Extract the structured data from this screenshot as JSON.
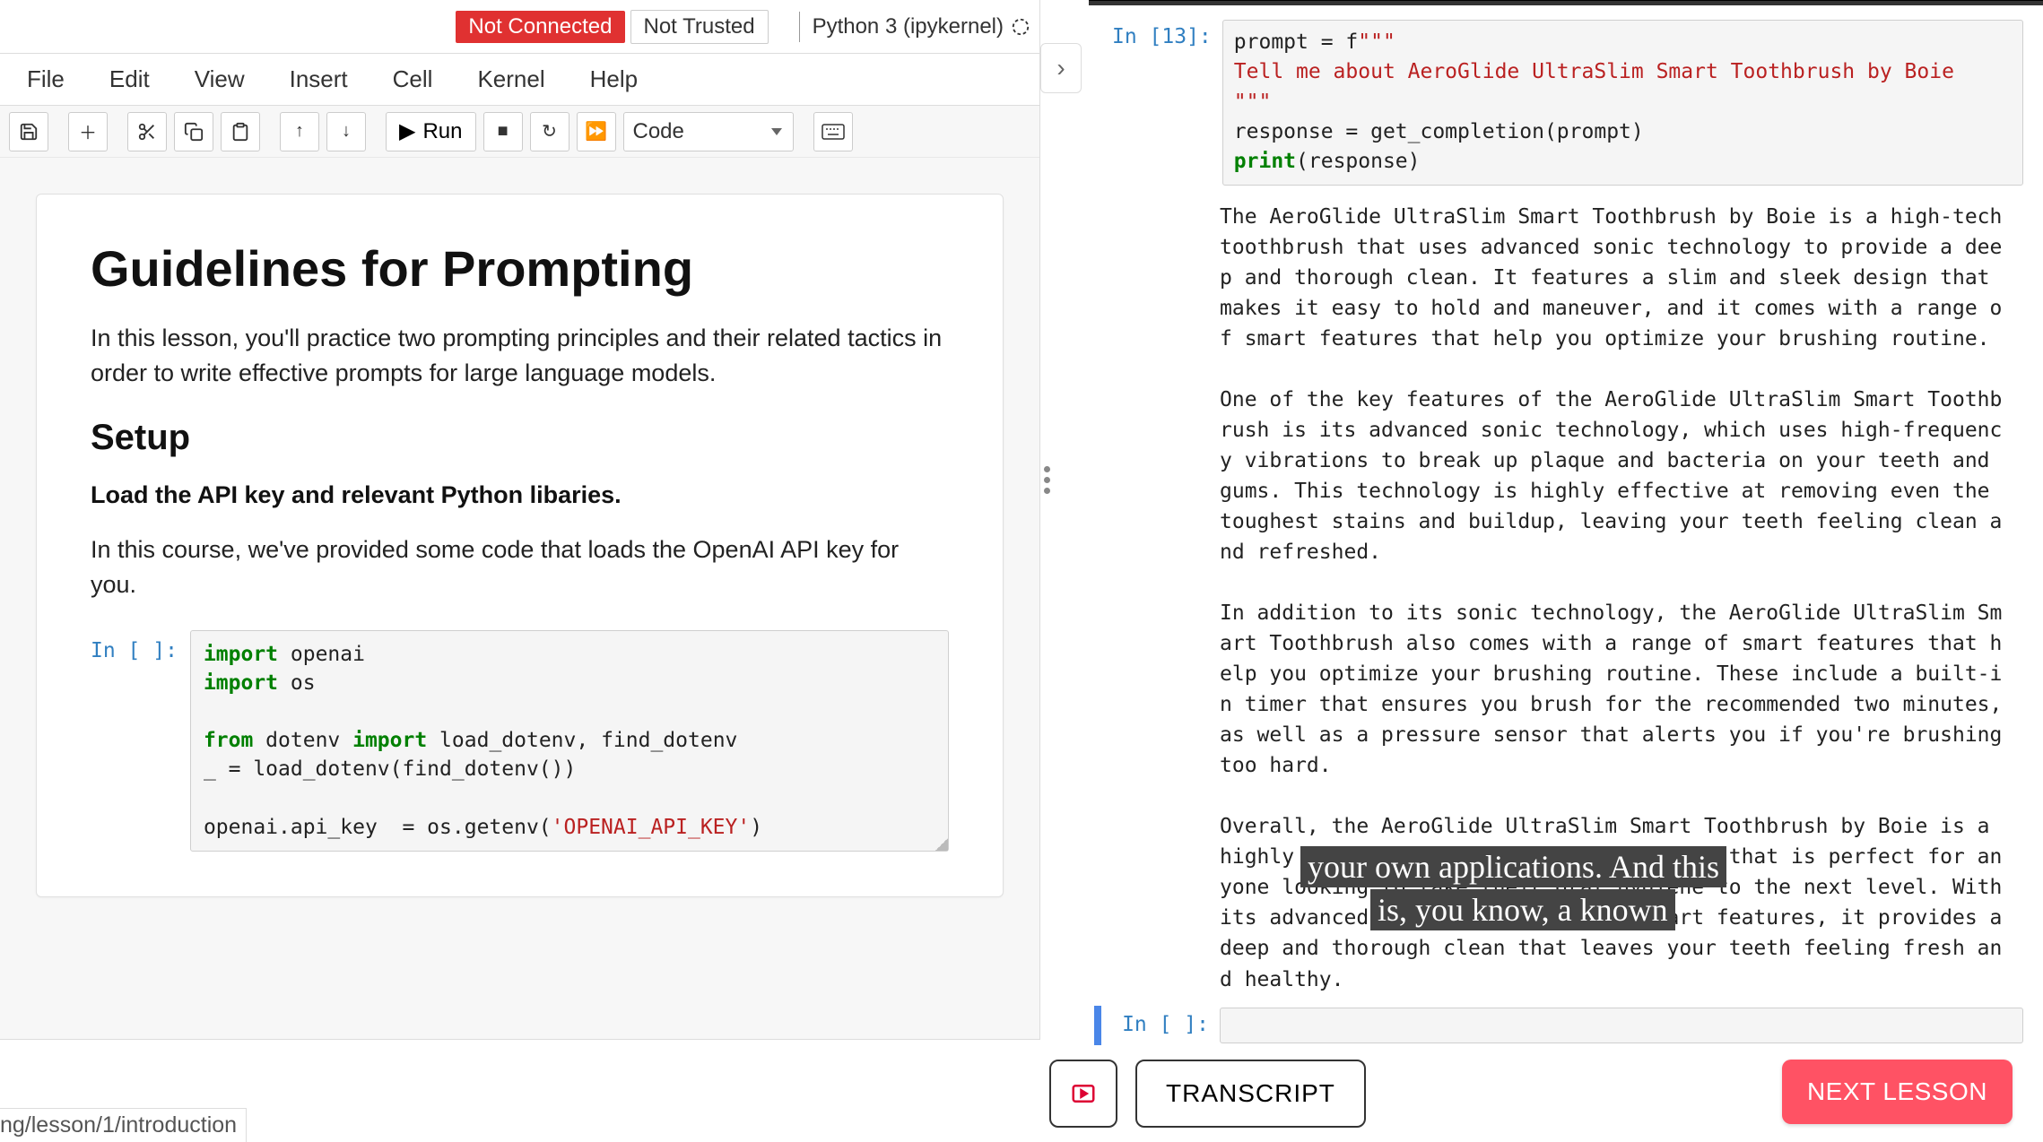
{
  "topbar": {
    "not_connected": "Not Connected",
    "not_trusted": "Not Trusted",
    "kernel": "Python 3 (ipykernel)"
  },
  "menu": [
    "File",
    "Edit",
    "View",
    "Insert",
    "Cell",
    "Kernel",
    "Help"
  ],
  "toolbar": {
    "run_label": "Run",
    "cell_type": "Code"
  },
  "md": {
    "h1": "Guidelines for Prompting",
    "p1": "In this lesson, you'll practice two prompting principles and their related tactics in order to write effective prompts for large language models.",
    "h2": "Setup",
    "h4": "Load the API key and relevant Python libaries.",
    "p2": "In this course, we've provided some code that loads the OpenAI API key for you."
  },
  "code_cell": {
    "prompt": "In [ ]:",
    "code_html": "<span class=\"kw\">import</span> openai\n<span class=\"kw\">import</span> os\n\n<span class=\"kw\">from</span> dotenv <span class=\"kw\">import</span> load_dotenv, find_dotenv\n_ = load_dotenv(find_dotenv())\n\nopenai.api_key  = os.getenv(<span class=\"str\">'OPENAI_API_KEY'</span>)"
  },
  "right": {
    "cell13_prompt": "In [13]:",
    "cell13_code_html": "prompt = f<span class=\"str\">\"\"\"</span>\n<span class=\"str\">Tell me about AeroGlide UltraSlim Smart Toothbrush by Boie</span>\n<span class=\"str\">\"\"\"</span>\nresponse = get_completion(prompt)\n<span class=\"kw\">print</span>(response)",
    "cell13_output": "The AeroGlide UltraSlim Smart Toothbrush by Boie is a high-tech toothbrush that uses advanced sonic technology to provide a deep and thorough clean. It features a slim and sleek design that makes it easy to hold and maneuver, and it comes with a range of smart features that help you optimize your brushing routine.\n\nOne of the key features of the AeroGlide UltraSlim Smart Toothbrush is its advanced sonic technology, which uses high-frequency vibrations to break up plaque and bacteria on your teeth and gums. This technology is highly effective at removing even the toughest stains and buildup, leaving your teeth feeling clean and refreshed.\n\nIn addition to its sonic technology, the AeroGlide UltraSlim Smart Toothbrush also comes with a range of smart features that help you optimize your brushing routine. These include a built-in timer that ensures you brush for the recommended two minutes, as well as a pressure sensor that alerts you if you're brushing too hard.\n\nOverall, the AeroGlide UltraSlim Smart Toothbrush by Boie is a highly advanced and effective toothbrush that is perfect for anyone looking to take their oral hygiene to the next level. With its advanced sonic technology and smart features, it provides a deep and thorough clean that leaves your teeth feeling fresh and healthy.",
    "empty_prompt": "In [ ]:"
  },
  "captions": {
    "line1": "your own applications. And this",
    "line2": "is, you know, a known"
  },
  "footer": {
    "path": "ng/lesson/1/introduction",
    "transcript": "TRANSCRIPT",
    "next": "NEXT LESSON"
  }
}
